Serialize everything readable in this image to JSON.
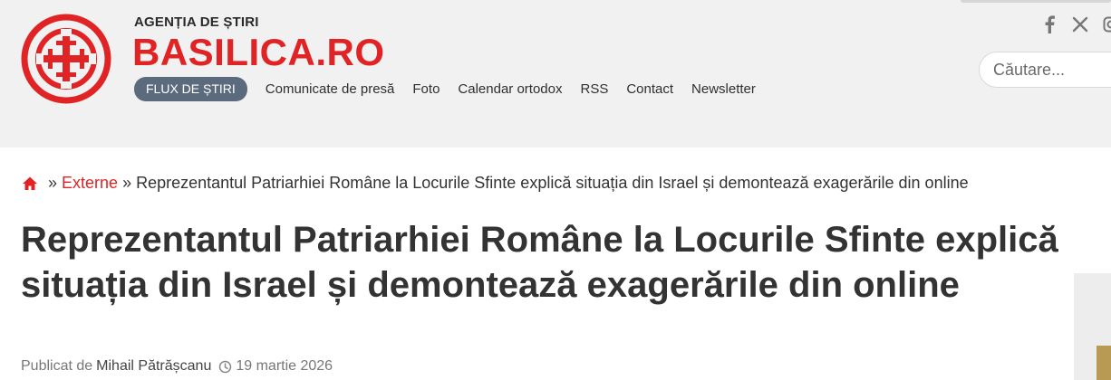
{
  "header": {
    "tagline": "AGENȚIA DE ȘTIRI",
    "brand": "BASILICA.RO",
    "nav": {
      "active": "FLUX DE ȘTIRI",
      "links": [
        "Comunicate de presă",
        "Foto",
        "Calendar ortodox",
        "RSS",
        "Contact",
        "Newsletter"
      ]
    },
    "social": [
      "facebook-icon",
      "x-icon",
      "instagram-icon"
    ],
    "search": {
      "placeholder": "Căutare..."
    }
  },
  "breadcrumb": {
    "sep": "»",
    "section": "Externe",
    "current": "Reprezentantul Patriarhiei Române la Locurile Sfinte explică situația din Israel și demontează exagerările din online"
  },
  "article": {
    "title": "Reprezentantul Patriarhiei Române la Locurile Sfinte explică situația din Israel și demontează exagerările din online",
    "published_prefix": "Publicat de",
    "author": "Mihail Pătrășcanu",
    "date": "19 martie 2026"
  },
  "colors": {
    "accent": "#e02426",
    "nav_pill": "#5b6b7d",
    "header_bg": "#f1f1f1"
  }
}
